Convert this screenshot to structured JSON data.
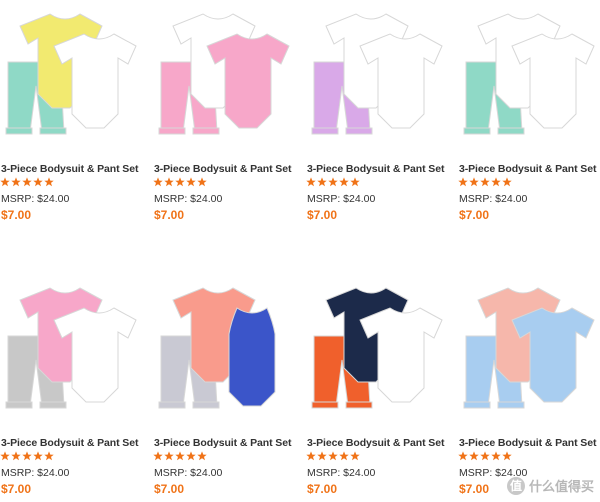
{
  "products": [
    {
      "title": "3-Piece Bodysuit & Pant Set",
      "rating": 5,
      "msrp": "MSRP: $24.00",
      "price": "$7.00",
      "image": "monkey-set",
      "colors": [
        "#8fd9c6",
        "#f2ea70",
        "#ffffff"
      ]
    },
    {
      "title": "3-Piece Bodysuit & Pant Set",
      "rating": 5,
      "msrp": "MSRP: $24.00",
      "price": "$7.00",
      "image": "ice-cream-set",
      "colors": [
        "#f7a7c9",
        "#ffffff",
        "#f7a7c9"
      ]
    },
    {
      "title": "3-Piece Bodysuit & Pant Set",
      "rating": 5,
      "msrp": "MSRP: $24.00",
      "price": "$7.00",
      "image": "whale-set",
      "colors": [
        "#d9a9e8",
        "#ffffff",
        "#ffffff"
      ]
    },
    {
      "title": "3-Piece Bodysuit & Pant Set",
      "rating": 5,
      "msrp": "MSRP: $24.00",
      "price": "$7.00",
      "image": "owl-set",
      "colors": [
        "#8fd9c6",
        "#ffffff",
        "#ffffff"
      ]
    },
    {
      "title": "3-Piece Bodysuit & Pant Set",
      "rating": 5,
      "msrp": "MSRP: $24.00",
      "price": "$7.00",
      "image": "flamingo-set",
      "colors": [
        "#c8c8c8",
        "#f7a7c9",
        "#ffffff"
      ]
    },
    {
      "title": "3-Piece Bodysuit & Pant Set",
      "rating": 5,
      "msrp": "MSRP: $24.00",
      "price": "$7.00",
      "image": "seahorse-set",
      "colors": [
        "#c9c9d3",
        "#f99b8c",
        "#3b55c9"
      ]
    },
    {
      "title": "3-Piece Bodysuit & Pant Set",
      "rating": 5,
      "msrp": "MSRP: $24.00",
      "price": "$7.00",
      "image": "orca-set",
      "colors": [
        "#f0602c",
        "#1c2a4a",
        "#ffffff"
      ]
    },
    {
      "title": "3-Piece Bodysuit & Pant Set",
      "rating": 5,
      "msrp": "MSRP: $24.00",
      "price": "$7.00",
      "image": "heart-set",
      "colors": [
        "#a8cdf0",
        "#f6b7ab",
        "#a8cdf0"
      ]
    }
  ],
  "colors": {
    "star": "#f07318",
    "price": "#f07318",
    "text": "#333333"
  },
  "watermark": {
    "text": "什么值得买",
    "icon": "值"
  }
}
